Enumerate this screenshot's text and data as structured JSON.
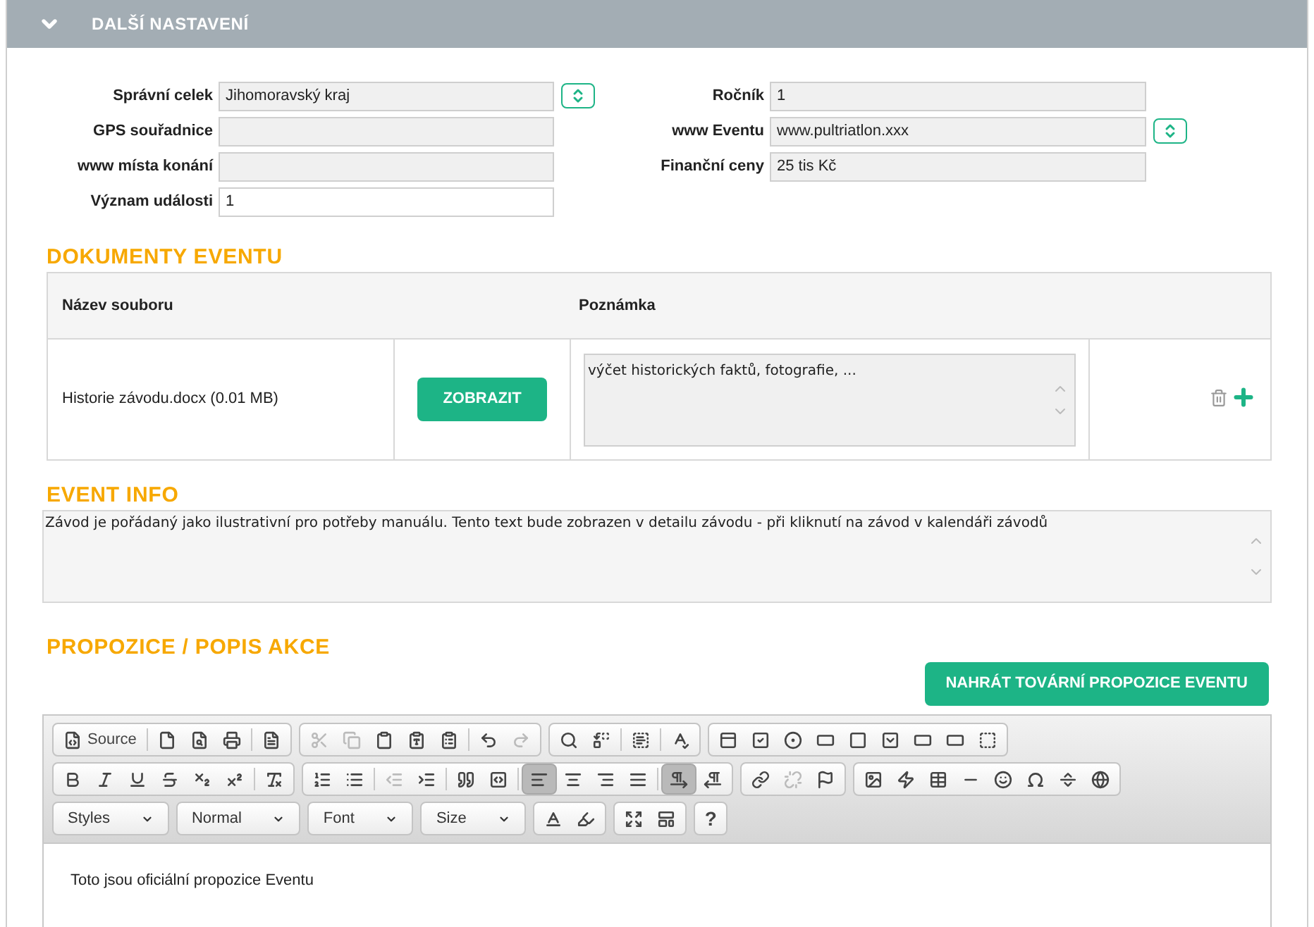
{
  "section": {
    "title": "DALŠÍ NASTAVENÍ",
    "expanded": true
  },
  "fields_left": [
    {
      "label": "Správní celek",
      "value": "Jihomoravský kraj",
      "disabled": true,
      "kind": "picker"
    },
    {
      "label": "GPS souřadnice",
      "disabled": true,
      "kind": "text"
    },
    {
      "label": "www místa konání",
      "disabled": true,
      "kind": "text"
    },
    {
      "label": "Význam události",
      "value": "1",
      "disabled": false,
      "kind": "text"
    }
  ],
  "fields_right": [
    {
      "label": "Ročník",
      "value": "1",
      "disabled": true,
      "kind": "text"
    },
    {
      "label": "www Eventu",
      "value": "www.pultriatlon.xxx",
      "disabled": true,
      "kind": "picker"
    },
    {
      "label": "Finanční ceny",
      "value": "25 tis Kč",
      "disabled": true,
      "kind": "text"
    }
  ],
  "documents": {
    "title": "DOKUMENTY EVENTU",
    "columns": [
      "Název souboru",
      "Poznámka"
    ],
    "rows": [
      {
        "file": "Historie závodu.docx (0.01 MB)",
        "button": "ZOBRAZIT",
        "note": "výčet historických faktů, fotografie, ..."
      }
    ]
  },
  "event_info": {
    "title": "EVENT INFO",
    "text": "Závod je pořádaný jako ilustrativní pro potřeby manuálu. Tento text bude zobrazen v detailu závodu - při kliknutí na závod v kalendáři závodů"
  },
  "propozice": {
    "title": "PROPOZICE / POPIS AKCE",
    "button": "NAHRÁT TOVÁRNÍ PROPOZICE EVENTU",
    "toolbar_rows": [
      [
        [
          {
            "kind": "source",
            "label": "Source",
            "disabled": false,
            "on": false
          },
          {
            "kind": "sep"
          },
          {
            "kind": "new-page",
            "disabled": false,
            "on": false
          },
          {
            "kind": "preview",
            "disabled": false,
            "on": false
          },
          {
            "kind": "print",
            "disabled": false,
            "on": false
          },
          {
            "kind": "sep"
          },
          {
            "kind": "templates",
            "disabled": false,
            "on": false
          }
        ],
        [
          {
            "kind": "cut",
            "disabled": true,
            "on": false
          },
          {
            "kind": "copy",
            "disabled": true,
            "on": false
          },
          {
            "kind": "paste",
            "disabled": false,
            "on": false
          },
          {
            "kind": "paste-text",
            "disabled": false,
            "on": false
          },
          {
            "kind": "paste-word",
            "disabled": false,
            "on": false
          },
          {
            "kind": "sep"
          },
          {
            "kind": "undo",
            "disabled": false,
            "on": false
          },
          {
            "kind": "redo",
            "disabled": true,
            "on": false
          }
        ],
        [
          {
            "kind": "find",
            "disabled": false,
            "on": false
          },
          {
            "kind": "replace",
            "disabled": false,
            "on": false
          },
          {
            "kind": "sep"
          },
          {
            "kind": "select-all",
            "disabled": false,
            "on": false
          },
          {
            "kind": "sep"
          },
          {
            "kind": "spellcheck",
            "disabled": false,
            "on": false
          }
        ],
        [
          {
            "kind": "form",
            "disabled": false,
            "on": false
          },
          {
            "kind": "checkbox",
            "disabled": false,
            "on": false
          },
          {
            "kind": "radio",
            "disabled": false,
            "on": false
          },
          {
            "kind": "textfield",
            "disabled": false,
            "on": false
          },
          {
            "kind": "textarea",
            "disabled": false,
            "on": false
          },
          {
            "kind": "select",
            "disabled": false,
            "on": false
          },
          {
            "kind": "button",
            "disabled": false,
            "on": false
          },
          {
            "kind": "image-button",
            "disabled": false,
            "on": false
          },
          {
            "kind": "hidden-field",
            "disabled": false,
            "on": false
          }
        ]
      ],
      [
        [
          {
            "kind": "bold",
            "disabled": false,
            "on": false
          },
          {
            "kind": "italic",
            "disabled": false,
            "on": false
          },
          {
            "kind": "underline",
            "disabled": false,
            "on": false
          },
          {
            "kind": "strike",
            "disabled": false,
            "on": false
          },
          {
            "kind": "subscript",
            "disabled": false,
            "on": false
          },
          {
            "kind": "superscript",
            "disabled": false,
            "on": false
          },
          {
            "kind": "sep"
          },
          {
            "kind": "remove-format",
            "disabled": false,
            "on": false
          }
        ],
        [
          {
            "kind": "numbered-list",
            "disabled": false,
            "on": false
          },
          {
            "kind": "bulleted-list",
            "disabled": false,
            "on": false
          },
          {
            "kind": "sep"
          },
          {
            "kind": "outdent",
            "disabled": true,
            "on": false
          },
          {
            "kind": "indent",
            "disabled": false,
            "on": false
          },
          {
            "kind": "sep"
          },
          {
            "kind": "blockquote",
            "disabled": false,
            "on": false
          },
          {
            "kind": "div",
            "disabled": false,
            "on": false
          },
          {
            "kind": "sep"
          },
          {
            "kind": "align-left",
            "disabled": false,
            "on": true
          },
          {
            "kind": "align-center",
            "disabled": false,
            "on": false
          },
          {
            "kind": "align-right",
            "disabled": false,
            "on": false
          },
          {
            "kind": "align-justify",
            "disabled": false,
            "on": false
          },
          {
            "kind": "sep"
          },
          {
            "kind": "ltr",
            "disabled": false,
            "on": true
          },
          {
            "kind": "rtl",
            "disabled": false,
            "on": false
          }
        ],
        [
          {
            "kind": "link",
            "disabled": false,
            "on": false
          },
          {
            "kind": "unlink",
            "disabled": true,
            "on": false
          },
          {
            "kind": "anchor",
            "disabled": false,
            "on": false
          }
        ],
        [
          {
            "kind": "image",
            "disabled": false,
            "on": false
          },
          {
            "kind": "flash",
            "disabled": false,
            "on": false
          },
          {
            "kind": "table",
            "disabled": false,
            "on": false
          },
          {
            "kind": "hline",
            "disabled": false,
            "on": false
          },
          {
            "kind": "smiley",
            "disabled": false,
            "on": false
          },
          {
            "kind": "special-char",
            "disabled": false,
            "on": false
          },
          {
            "kind": "page-break",
            "disabled": false,
            "on": false
          },
          {
            "kind": "iframe",
            "disabled": false,
            "on": false
          }
        ]
      ],
      [
        [
          {
            "kind": "combo",
            "label": "Styles"
          }
        ],
        [
          {
            "kind": "combo",
            "label": "Normal"
          }
        ],
        [
          {
            "kind": "combo",
            "label": "Font"
          }
        ],
        [
          {
            "kind": "combo",
            "label": "Size"
          }
        ],
        [
          {
            "kind": "text-color",
            "disabled": false,
            "on": false
          },
          {
            "kind": "bg-color",
            "disabled": false,
            "on": false
          }
        ],
        [
          {
            "kind": "maximize",
            "disabled": false,
            "on": false
          },
          {
            "kind": "show-blocks",
            "disabled": false,
            "on": false
          }
        ],
        [
          {
            "kind": "help",
            "label": "?",
            "disabled": false,
            "on": false
          }
        ]
      ]
    ],
    "content": "Toto jsou oficiální propozice Eventu"
  }
}
